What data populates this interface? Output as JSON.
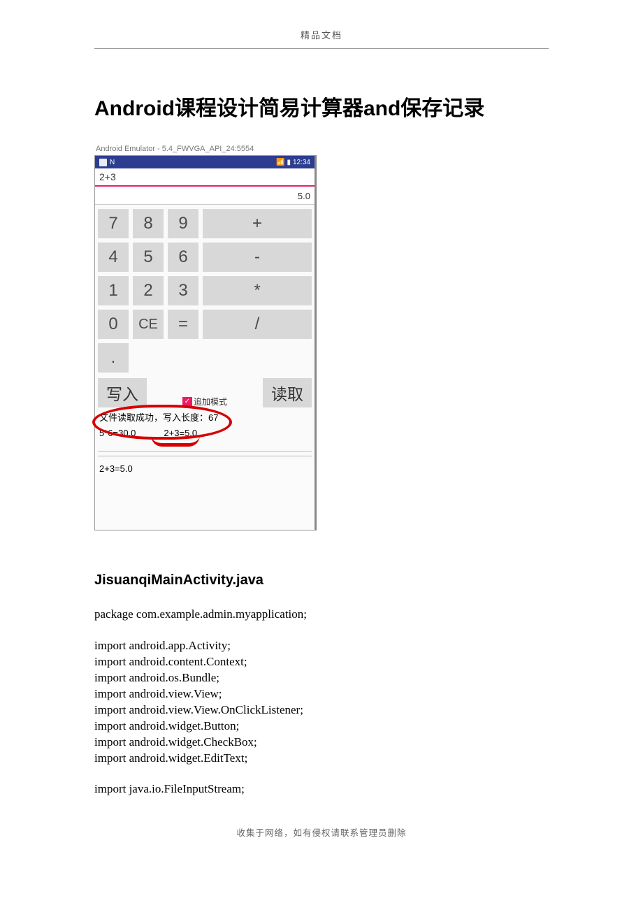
{
  "header": "精品文档",
  "title": "Android课程设计简易计算器and保存记录",
  "emulator": {
    "caption": "Android Emulator - 5.4_FWVGA_API_24:5554",
    "statusbar_left_letter": "N",
    "statusbar_time": "12:34",
    "expression": "2+3",
    "result": "5.0",
    "keys": {
      "r1": [
        "7",
        "8",
        "9",
        "+"
      ],
      "r2": [
        "4",
        "5",
        "6",
        "-"
      ],
      "r3": [
        "1",
        "2",
        "3",
        "*"
      ],
      "r4": [
        "0",
        "CE",
        "=",
        "/"
      ],
      "dot": "."
    },
    "write_label": "写入",
    "read_label": "读取",
    "append_label": "追加模式",
    "append_checked": true,
    "status_line": "文件读取成功，写入长度：67",
    "saved1": "5*6=30.0",
    "saved2": "2+3=5.0",
    "history_line": "2+3=5.0"
  },
  "section_heading": "JisuanqiMainActivity.java",
  "code_lines": [
    "package com.example.admin.myapplication;",
    "",
    "import android.app.Activity;",
    "import android.content.Context;",
    "import android.os.Bundle;",
    "import android.view.View;",
    "import android.view.View.OnClickListener;",
    "import android.widget.Button;",
    "import android.widget.CheckBox;",
    "import android.widget.EditText;",
    "",
    "import java.io.FileInputStream;"
  ],
  "footer": "收集于网络，如有侵权请联系管理员删除"
}
